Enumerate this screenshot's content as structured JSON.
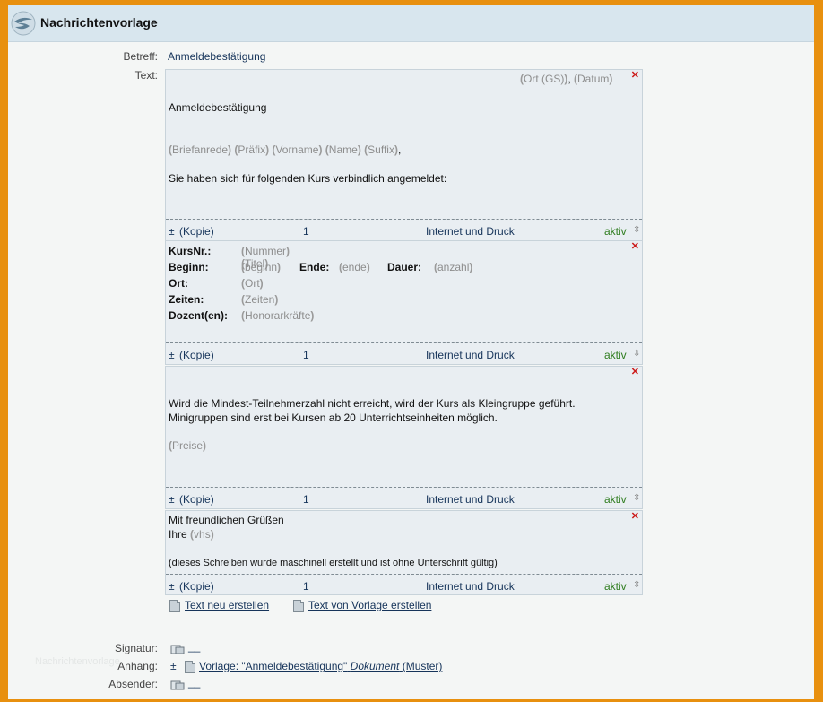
{
  "window": {
    "title": "Nachrichtenvorlage"
  },
  "form": {
    "betreff_label": "Betreff:",
    "betreff_value": "Anmeldebestätigung",
    "text_label": "Text:",
    "signatur_label": "Signatur:",
    "signatur_value": "__",
    "anhang_label": "Anhang:",
    "anhang_plus": "±",
    "anhang_prefix": "Vorlage: \"Anmeldebestätigung\"",
    "anhang_italic": "Dokument",
    "anhang_suffix": "(Muster)",
    "absender_label": "Absender:",
    "absender_value": "__",
    "watermark": "Nachrichtenvorlage"
  },
  "footer": {
    "plusminus": "±",
    "kopie": "(Kopie)",
    "count": "1",
    "mode": "Internet und Druck",
    "status": "aktiv",
    "updown": "⇳"
  },
  "blocks": {
    "b1": {
      "ort": "Ort (GS)",
      "comma": ",",
      "datum": "Datum",
      "heading": "Anmeldebestätigung",
      "briefanrede": "Briefanrede",
      "praefix": "Präfix",
      "vorname": "Vorname",
      "name": "Name",
      "suffix": "Suffix",
      "trailing_comma": ",",
      "sentence": "Sie haben sich für folgenden Kurs verbindlich angemeldet:"
    },
    "b2": {
      "kursnr_label": "KursNr.:",
      "nummer": "Nummer",
      "titel": "Titel",
      "beginn_label": "Beginn:",
      "beginn": "beginn",
      "ende_label": "Ende:",
      "ende": "ende",
      "dauer_label": "Dauer:",
      "anzahl": "anzahl",
      "ort_label": "Ort:",
      "ort": "Ort",
      "zeiten_label": "Zeiten:",
      "zeiten": "Zeiten",
      "dozent_label": "Dozent(en):",
      "honorar": "Honorarkräfte"
    },
    "b3": {
      "line1": "Wird die Mindest-Teilnehmerzahl nicht erreicht, wird der Kurs als Kleingruppe geführt.",
      "line2": "Minigruppen sind erst bei Kursen ab 20 Unterrichtseinheiten möglich.",
      "preise": "Preise"
    },
    "b4": {
      "line1": "Mit freundlichen Grüßen",
      "ihre": "Ihre",
      "vhs": "vhs",
      "note": "(dieses Schreiben wurde maschinell erstellt und ist ohne Unterschrift gültig)"
    }
  },
  "actions": {
    "new_text": "Text neu erstellen",
    "from_template": "Text von Vorlage erstellen"
  },
  "icons": {
    "logo": "app-logo-icon",
    "remove": "remove-x-icon",
    "document": "document-icon",
    "signature": "signature-icon",
    "sort": "sort-updown-icon"
  },
  "colors": {
    "accent_frame": "#e8900f",
    "header_bg": "#d8e6ee",
    "link": "#16345a",
    "active": "#2f7d1f",
    "remove": "#cc1a1a"
  }
}
